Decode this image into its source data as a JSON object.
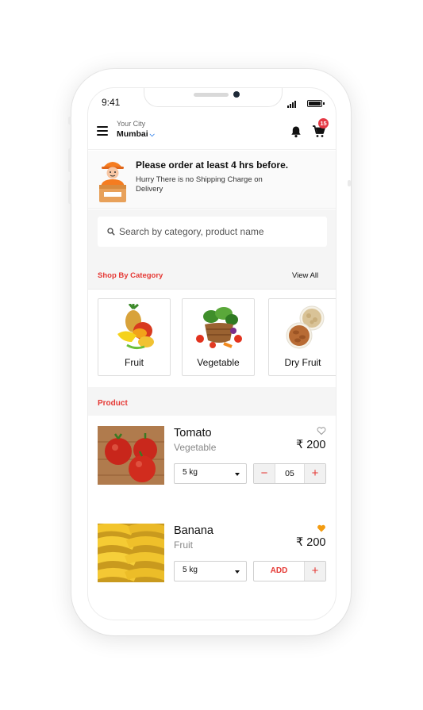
{
  "status": {
    "time": "9:41"
  },
  "header": {
    "city_label": "Your City",
    "city_value": "Mumbai",
    "cart_count": "15",
    "icons": [
      "menu-icon",
      "bell-icon",
      "cart-icon",
      "chevron-down-icon"
    ]
  },
  "notice": {
    "title": "Please order at least 4 hrs before.",
    "subtitle": "Hurry There is no Shipping Charge on Delivery"
  },
  "search": {
    "placeholder": "Search by category, product name"
  },
  "categories": {
    "title": "Shop By Category",
    "view_all": "View All",
    "items": [
      {
        "label": "Fruit"
      },
      {
        "label": "Vegetable"
      },
      {
        "label": "Dry Fruit"
      }
    ]
  },
  "products": {
    "title": "Product",
    "items": [
      {
        "name": "Tomato",
        "category": "Vegetable",
        "price": "₹ 200",
        "weight": "5 kg",
        "quantity": "05",
        "favorite": false
      },
      {
        "name": "Banana",
        "category": "Fruit",
        "price": "₹ 200",
        "weight": "5 kg",
        "add_label": "ADD",
        "favorite": true
      }
    ]
  },
  "colors": {
    "accent": "#e53935",
    "favorite": "#f39c12",
    "link": "#1a73e8"
  }
}
